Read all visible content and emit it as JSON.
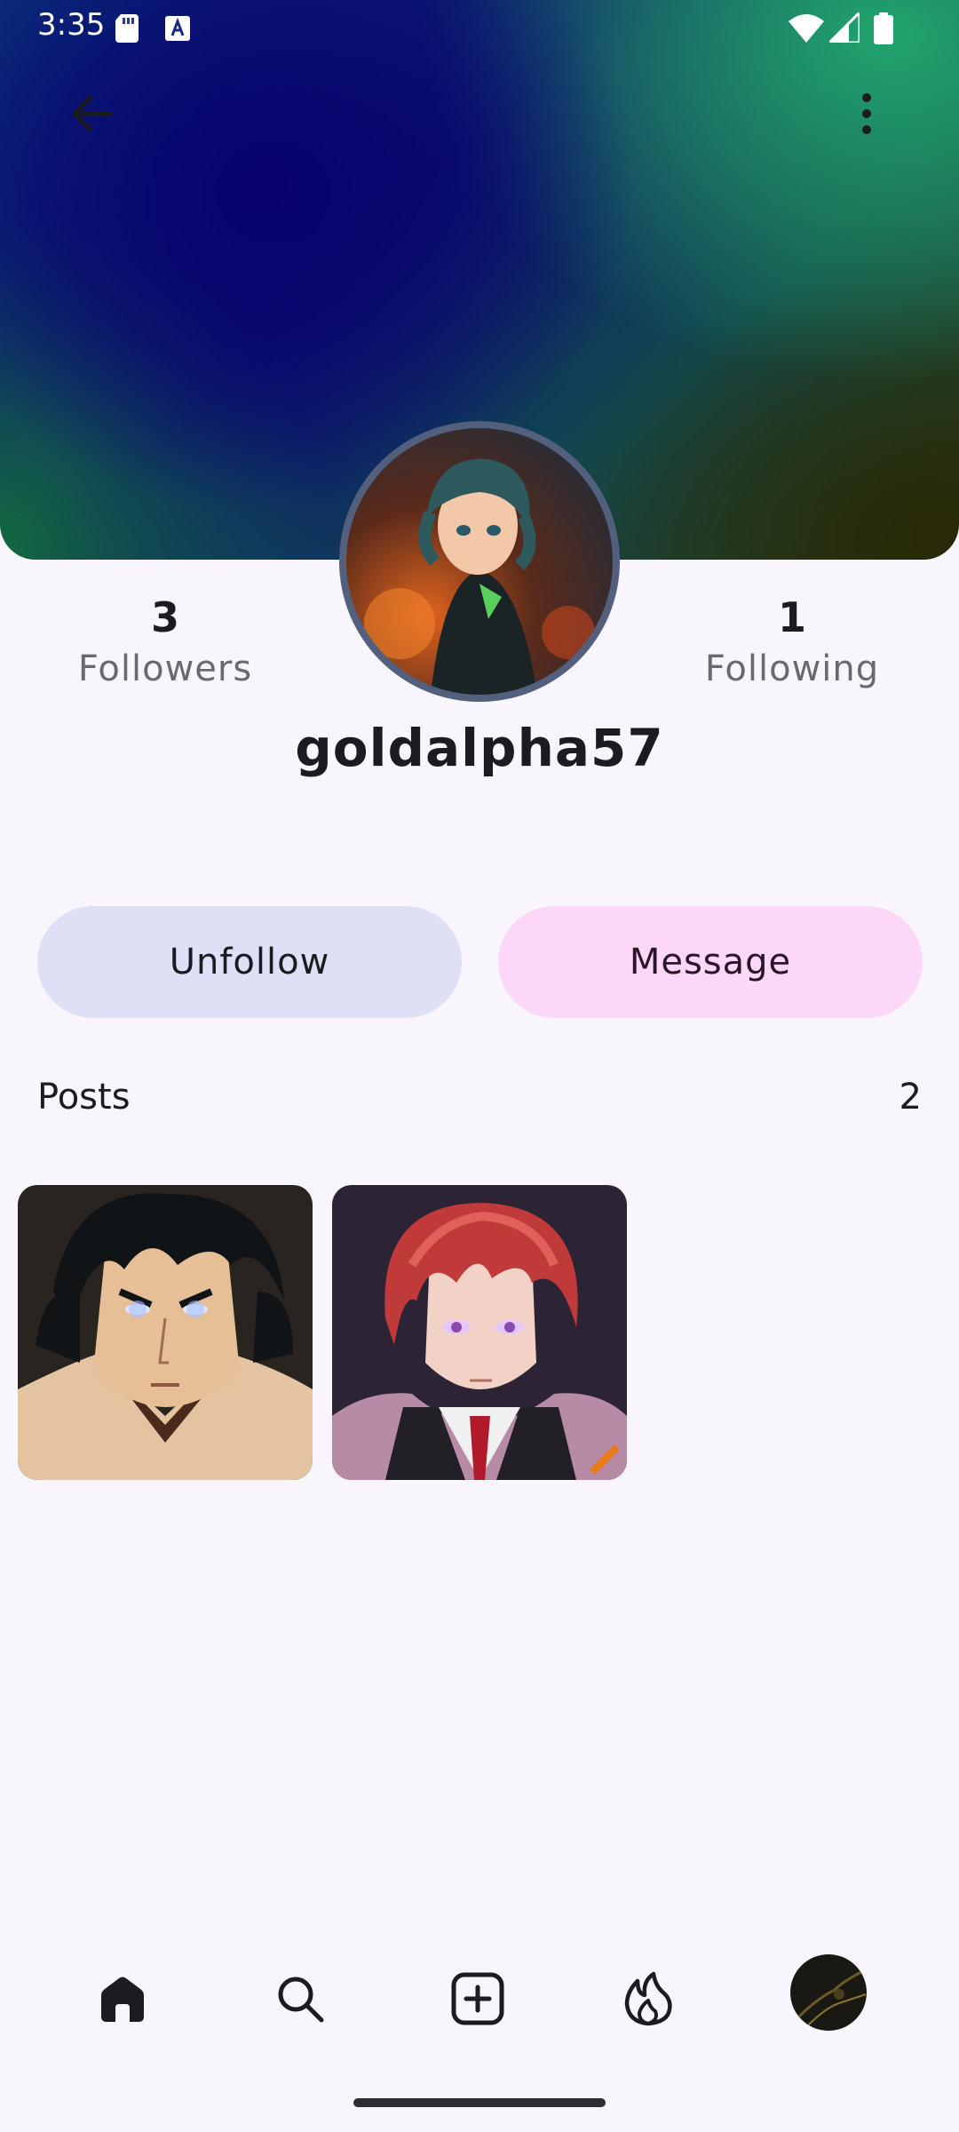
{
  "status_bar": {
    "time": "3:35",
    "icons": [
      "sd-card-icon",
      "a-notification-icon",
      "wifi-icon",
      "signal-icon",
      "battery-icon"
    ]
  },
  "header": {
    "back_icon": "arrow-back-icon",
    "more_icon": "more-vertical-icon"
  },
  "profile": {
    "followers_count": "3",
    "followers_label": "Followers",
    "following_count": "1",
    "following_label": "Following",
    "username": "goldalpha57"
  },
  "actions": {
    "unfollow_label": "Unfollow",
    "message_label": "Message"
  },
  "posts": {
    "title": "Posts",
    "count": "2",
    "items": [
      {
        "description_icon": "anime-portrait-dark-hair"
      },
      {
        "description_icon": "anime-portrait-red-hair"
      }
    ]
  },
  "bottom_nav": {
    "items": [
      "home-icon",
      "search-icon",
      "add-post-icon",
      "trending-icon",
      "profile-avatar"
    ]
  },
  "colors": {
    "background": "#f8f6fc",
    "unfollow_bg": "#dee1f6",
    "message_bg": "#fcd7f7",
    "avatar_ring": "#52607e"
  }
}
